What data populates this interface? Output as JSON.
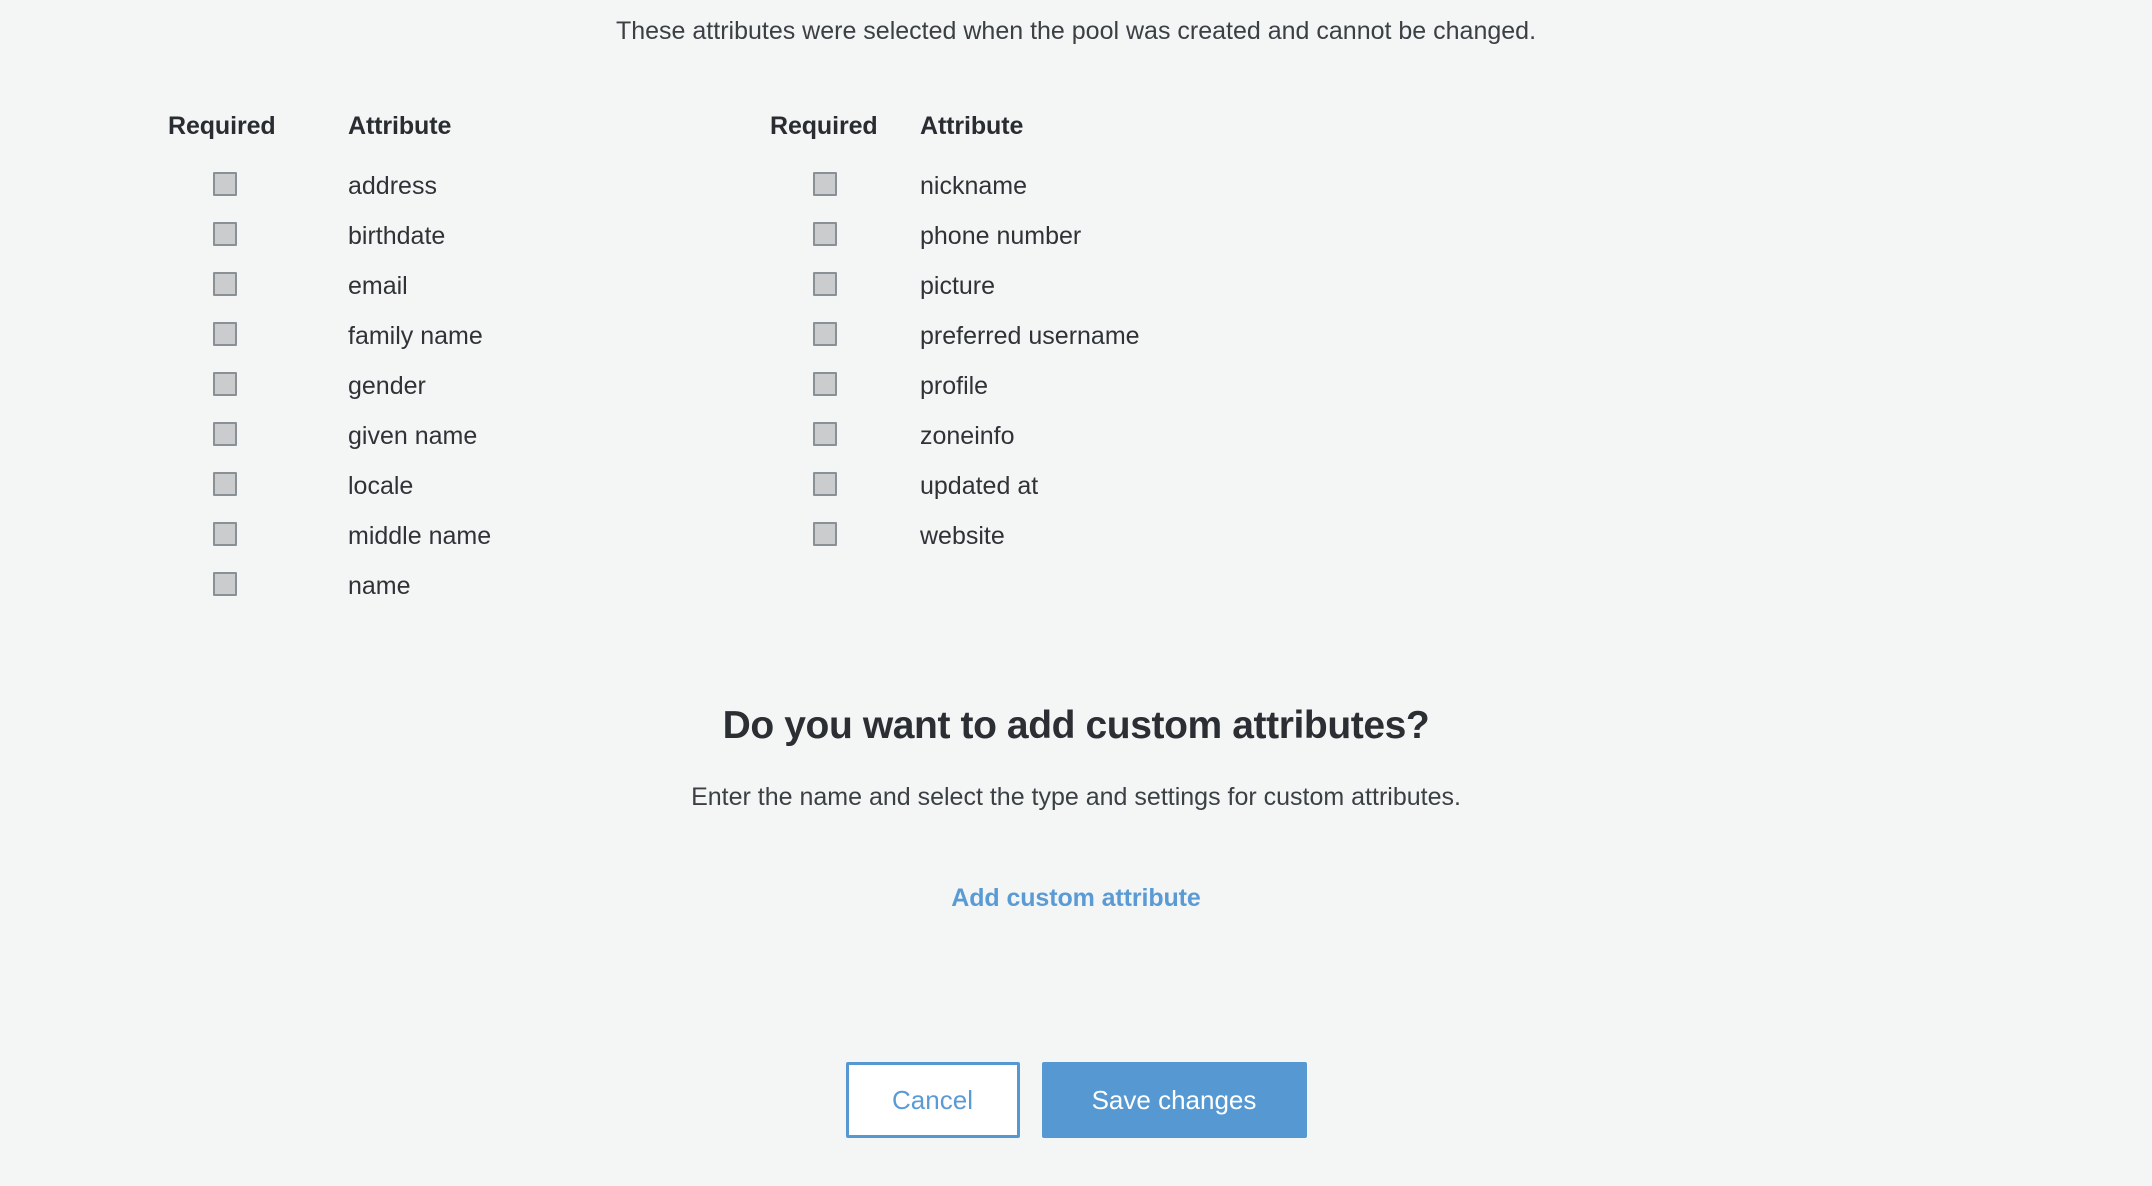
{
  "intro": {
    "note": "These attributes were selected when the pool was created and cannot be changed."
  },
  "attributes_table": {
    "headers": {
      "required": "Required",
      "attribute": "Attribute"
    },
    "columns": [
      {
        "header_required": "Required",
        "header_attribute": "Attribute",
        "rows": [
          {
            "name": "address",
            "required": false
          },
          {
            "name": "birthdate",
            "required": false
          },
          {
            "name": "email",
            "required": false
          },
          {
            "name": "family name",
            "required": false
          },
          {
            "name": "gender",
            "required": false
          },
          {
            "name": "given name",
            "required": false
          },
          {
            "name": "locale",
            "required": false
          },
          {
            "name": "middle name",
            "required": false
          },
          {
            "name": "name",
            "required": false
          }
        ]
      },
      {
        "header_required": "Required",
        "header_attribute": "Attribute",
        "rows": [
          {
            "name": "nickname",
            "required": false
          },
          {
            "name": "phone number",
            "required": false
          },
          {
            "name": "picture",
            "required": false
          },
          {
            "name": "preferred username",
            "required": false
          },
          {
            "name": "profile",
            "required": false
          },
          {
            "name": "zoneinfo",
            "required": false
          },
          {
            "name": "updated at",
            "required": false
          },
          {
            "name": "website",
            "required": false
          }
        ]
      }
    ]
  },
  "custom_attributes": {
    "title": "Do you want to add custom attributes?",
    "subtitle": "Enter the name and select the type and settings for custom attributes.",
    "add_link_label": "Add custom attribute"
  },
  "footer": {
    "cancel_label": "Cancel",
    "save_label": "Save changes"
  },
  "colors": {
    "page_background": "#f4f5f5",
    "accent_blue": "#5699d2",
    "link_blue": "#5b9bd5",
    "text_primary": "#2b2f33",
    "checkbox_fill": "#cbcccd",
    "checkbox_border": "#8a9196",
    "button_text_on_accent": "#ffffff"
  }
}
